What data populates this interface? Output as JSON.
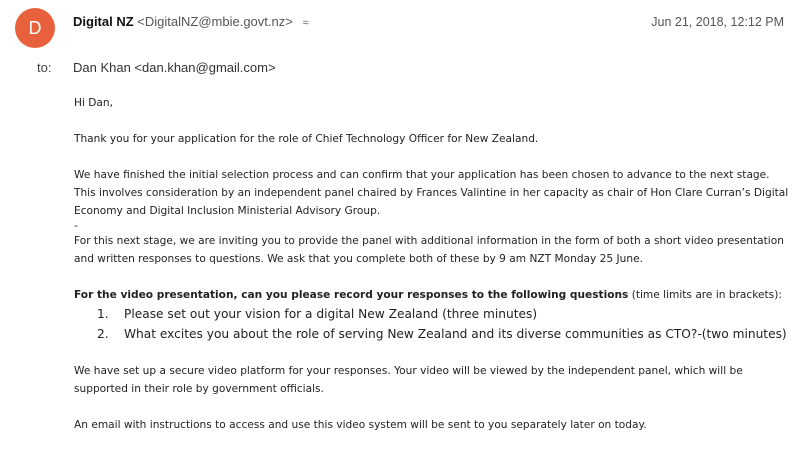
{
  "header": {
    "avatar_letter": "D",
    "avatar_color": "#e8613c",
    "sender_name": "Digital NZ",
    "sender_email": "<DigitalNZ@mbie.govt.nz>",
    "expand_glyph": "≈",
    "date": "Jun 21, 2018, 12:12 PM",
    "to_label": "to:",
    "to_value": "Dan Khan <dan.khan@gmail.com>"
  },
  "body": {
    "greeting": "Hi Dan,",
    "p1": "Thank you for your application for the role of Chief Technology Officer for New Zealand.",
    "p2": "We have finished the initial selection process and can confirm that your application has been chosen to advance to the next stage. This involves consideration by an independent panel chaired by Frances Valintine in her capacity as chair of Hon Clare Curran’s Digital Economy and Digital Inclusion Ministerial Advisory Group.",
    "dash": "-",
    "p3": "For this next stage, we are inviting you to provide the panel with additional information in the form of both a short video presentation and written responses to questions.  We ask that you complete both of these by 9 am NZT Monday 25 June.",
    "p4_bold": "For the video presentation, can you please record your responses to the following questions",
    "p4_rest": " (time limits are in brackets):",
    "questions": [
      {
        "num": "1.",
        "text": "Please set out your vision for a digital New Zealand (three minutes)"
      },
      {
        "num": "2.",
        "text": "What excites you about the role of serving New Zealand and its diverse communities as CTO?-(two minutes)"
      }
    ],
    "p5": "We have set up a secure video platform for your responses. Your video will be viewed by the independent panel, which will be supported in their role by government officials.",
    "p6": "An email with instructions to access and use this video system will be sent to you separately later on today."
  }
}
